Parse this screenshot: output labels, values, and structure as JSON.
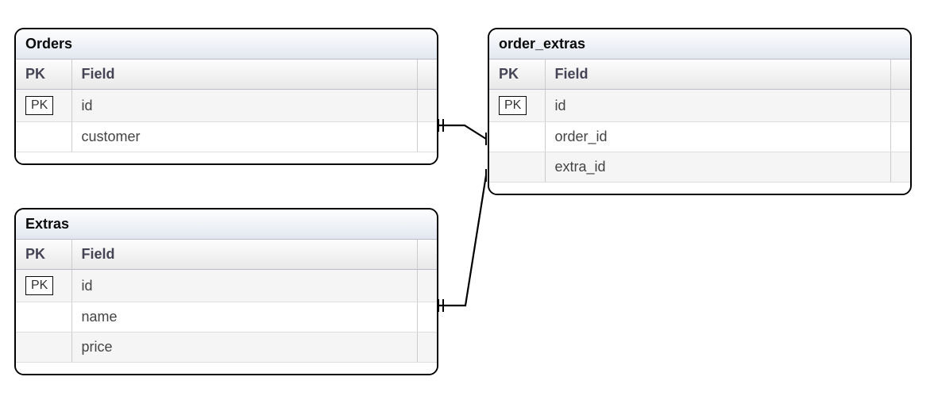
{
  "tables": {
    "orders": {
      "title": "Orders",
      "columns": {
        "pk": "PK",
        "field": "Field"
      },
      "rows": [
        {
          "pk": "PK",
          "field": "id"
        },
        {
          "pk": "",
          "field": "customer"
        }
      ]
    },
    "order_extras": {
      "title": "order_extras",
      "columns": {
        "pk": "PK",
        "field": "Field"
      },
      "rows": [
        {
          "pk": "PK",
          "field": "id"
        },
        {
          "pk": "",
          "field": "order_id"
        },
        {
          "pk": "",
          "field": "extra_id"
        }
      ]
    },
    "extras": {
      "title": "Extras",
      "columns": {
        "pk": "PK",
        "field": "Field"
      },
      "rows": [
        {
          "pk": "PK",
          "field": "id"
        },
        {
          "pk": "",
          "field": "name"
        },
        {
          "pk": "",
          "field": "price"
        }
      ]
    }
  }
}
